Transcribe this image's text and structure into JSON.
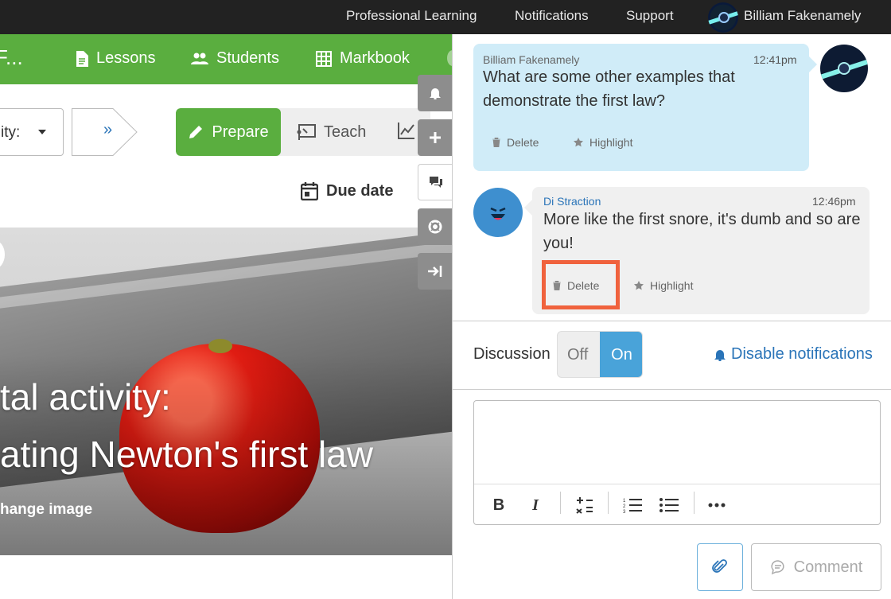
{
  "topbar": {
    "links": [
      "Professional Learning",
      "Notifications",
      "Support"
    ],
    "user_name": "Billiam Fakenamely"
  },
  "nav": {
    "title_fragment": "F...",
    "items": [
      {
        "label": "Lessons",
        "icon": "document-icon"
      },
      {
        "label": "Students",
        "icon": "users-icon"
      },
      {
        "label": "Markbook",
        "icon": "grid-icon"
      }
    ]
  },
  "toolbar": {
    "activity_select_label": "ity:",
    "next_label": "»",
    "modes": [
      "Prepare",
      "Teach"
    ],
    "active_mode": "Prepare",
    "due_date_label": "Due date"
  },
  "hero": {
    "title_line1": "tal activity:",
    "title_line2": "ating Newton's first law",
    "change_image": "hange image"
  },
  "side_tabs": [
    "bell-icon",
    "plus-icon",
    "chat-icon",
    "support-icon",
    "collapse-icon"
  ],
  "discussion": {
    "messages": [
      {
        "author": "Billiam Fakenamely",
        "time": "12:41pm",
        "body": "What are some other examples that demonstrate the first law?",
        "delete_label": "Delete",
        "highlight_label": "Highlight"
      },
      {
        "author": "Di Straction",
        "time": "12:46pm",
        "body": "More like the first snore, it's dumb and so are you!",
        "delete_label": "Delete",
        "highlight_label": "Highlight"
      }
    ],
    "discussion_label": "Discussion",
    "toggle_off": "Off",
    "toggle_on": "On",
    "toggle_state": "On",
    "disable_notifications": "Disable notifications",
    "editor_placeholder": "",
    "comment_label": "Comment",
    "colors": {
      "accent_green": "#5aae3f",
      "accent_blue": "#2a74b8",
      "highlight_outline": "#f0623d",
      "bubble_own": "#d0ecf8"
    }
  }
}
